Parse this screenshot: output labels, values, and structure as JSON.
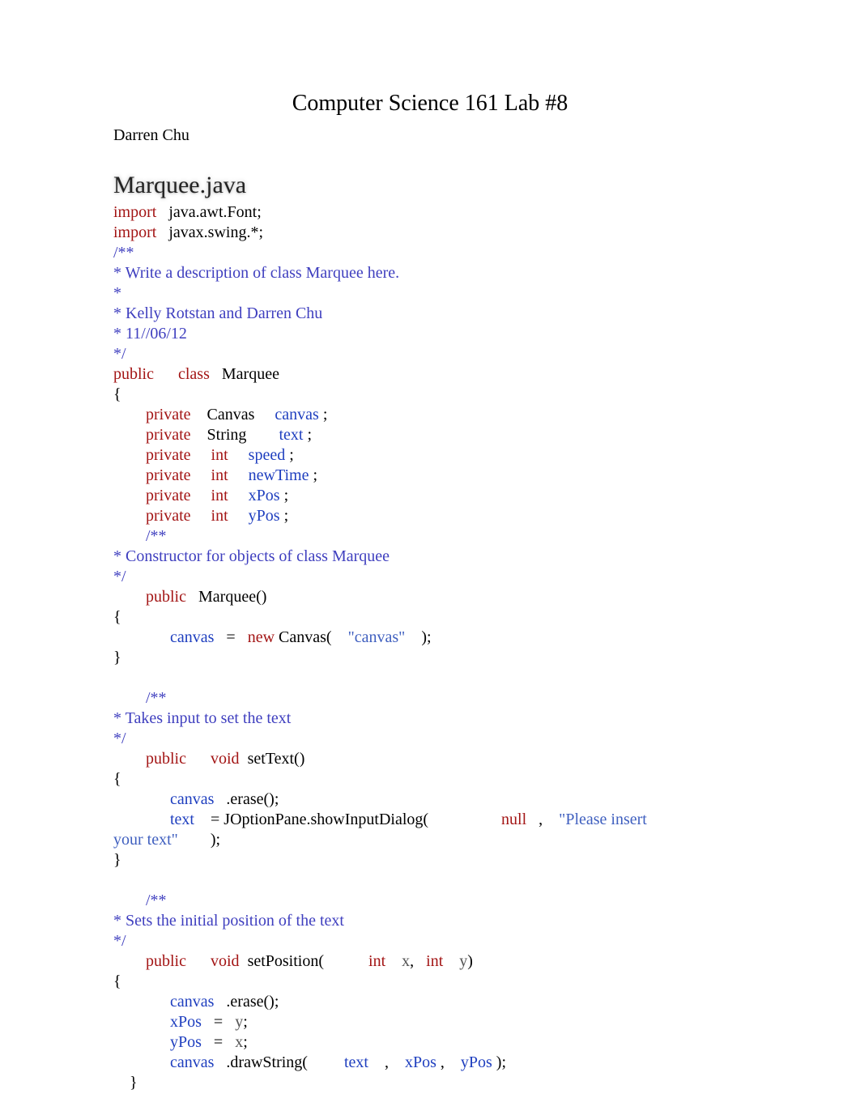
{
  "header": {
    "title": "Computer Science 161 Lab #8",
    "author": "Darren Chu"
  },
  "section": {
    "filename": "Marquee.java"
  },
  "code": {
    "l1_import": "import",
    "l1_rest": "   java.awt.Font;",
    "l2_import": "import",
    "l2_rest": "   javax.swing.*;",
    "c1": "/**",
    "c2": "* Write a description of class Marquee here.",
    "c3": "*",
    "c4": "* Kelly Rotstan and Darren Chu",
    "c5": "* 11//06/12",
    "c6": "*/",
    "l7_public": "public",
    "l7_class": "class",
    "l7_name": "   Marquee",
    "brace_open": "{",
    "indent1": "        ",
    "indent2": "              ",
    "f1_private": "private",
    "f1_type": "    Canvas     ",
    "f1_name": "canvas",
    "semicolon_sp": " ;",
    "f2_private": "private",
    "f2_type": "    String        ",
    "f2_name": "text",
    "f3_private": "private",
    "f3_int": "int",
    "f3_pad": "     ",
    "f3_name": "speed",
    "f4_private": "private",
    "f4_int": "int",
    "f4_name": "newTime",
    "f5_private": "private",
    "f5_int": "int",
    "f5_name": "xPos",
    "f6_private": "private",
    "f6_int": "int",
    "f6_name": "yPos",
    "cc1": "/**",
    "cc_ctor": "* Constructor for objects of class Marquee",
    "cc_end": "*/",
    "ctor_public": "public",
    "ctor_sig": "   Marquee()",
    "body_indent": "              ",
    "ctor_canvas": "canvas",
    "ctor_eq": "   =   ",
    "ctor_new": "new",
    "ctor_call1": " Canvas(    ",
    "ctor_str": "\"canvas\"",
    "ctor_call2": "    );",
    "brace_close": "}",
    "c_set": "* Takes input to set the text",
    "setText_public": "public",
    "setText_void": "void",
    "setText_sig": "  setText()",
    "setText_l1a": "canvas",
    "setText_l1b": "   .erase();",
    "setText_l2a": "text",
    "setText_l2b": "    = JOptionPane.showInputDialog(                  ",
    "setText_null": "null",
    "setText_l2c": "   ,    ",
    "setText_str": "\"Please insert ",
    "setText_str2": "your text\"",
    "setText_l2d": "        );",
    "c_pos": "* Sets the initial position of the text",
    "setPos_public": "public",
    "setPos_void": "void",
    "setPos_name": "  setPosition(           ",
    "setPos_int1": "int",
    "setPos_x": "    x",
    "setPos_comma": ",   ",
    "setPos_int2": "int",
    "setPos_y": "    y",
    "setPos_close": ")",
    "setPos_l1a": "canvas",
    "setPos_l1b": "   .erase();",
    "setPos_l2a": "xPos",
    "setPos_l2b": "   =   ",
    "setPos_l2c": "y",
    "setPos_l2d": ";",
    "setPos_l3a": "yPos",
    "setPos_l3b": "   =   ",
    "setPos_l3c": "x",
    "setPos_l3d": ";",
    "setPos_l4a": "canvas",
    "setPos_l4b": "   .drawString(         ",
    "setPos_l4c": "text",
    "setPos_l4d": "    ,    ",
    "setPos_l4e": "xPos",
    "setPos_l4f": " ,    ",
    "setPos_l4g": "yPos",
    "setPos_l4h": " );",
    "brace_close_indent": "    }",
    "gap4": "     ",
    "gap5": "      "
  }
}
